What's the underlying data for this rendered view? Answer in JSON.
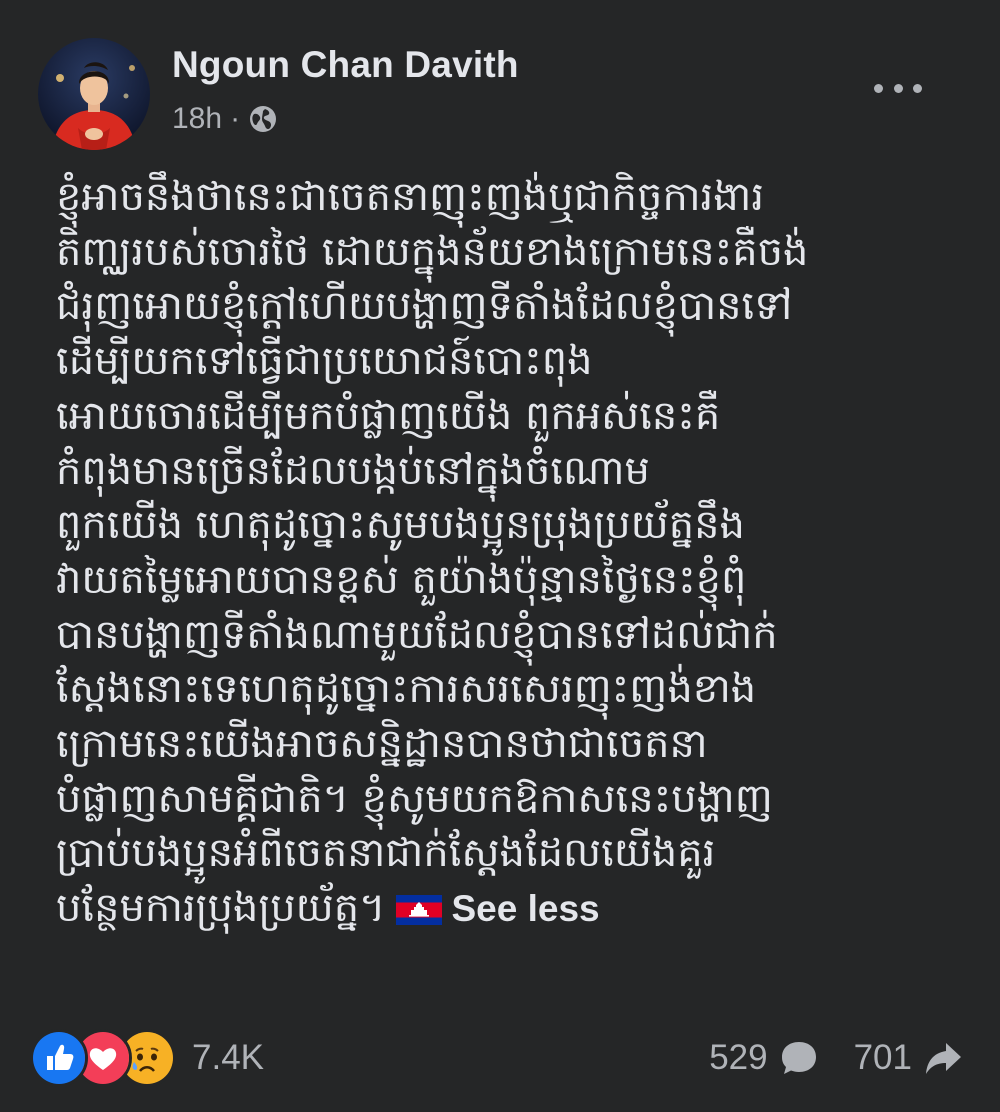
{
  "post": {
    "author": "Ngoun Chan Davith",
    "time": "18h",
    "separator": "·",
    "privacy_icon": "globe-icon",
    "more_icon": "ellipsis-icon",
    "lines": [
      "ខ្ញុំអាចនឹងថានេះជាចេតនាញុះញង់ឬជាកិច្ចការងារ",
      "តិញ្ឈរបស់ចោរថៃ ដោយក្នុងន័យខាងក្រោមនេះគឺចង់",
      "ជំរុញអោយខ្ញុំក្តៅហើយបង្ហាញទីតាំងដែលខ្ញុំបានទៅ",
      "ដើម្បីយកទៅធ្វើជាប្រយោជន៍បោះពុង",
      "អោយចោរដើម្បីមកបំផ្លាញយើង ពួកអស់នេះគឺ",
      "កំពុងមានច្រើនដែលបង្កប់នៅក្នុងចំណោម",
      "ពួកយើង ហេតុដូច្នោះសូមបងប្អូនប្រុងប្រយ័ត្ននឹង",
      "វាយតម្លៃអោយបានខ្ពស់ តួយ៉ាងប៉ុន្មានថ្ងៃនេះខ្ញុំពុំ",
      "បានបង្ហាញទីតាំងណាមួយដែលខ្ញុំបានទៅដល់ជាក់",
      "ស្តែងនោះទេហេតុដូច្នោះការសរសេរញុះញង់ខាង",
      "ក្រោមនេះយើងអាចសន្និដ្ឋានបានថាជាចេតនា",
      "បំផ្លាញសាមគ្គីជាតិ។ ខ្ញុំសូមយកឱកាសនេះបង្ហាញ",
      "ប្រាប់បងប្អូនអំពីចេតនាជាក់ស្តែងដែលយើងគួរ"
    ],
    "last_line": "បន្ថែមការប្រុងប្រយ័ត្ន។",
    "flag_icon": "cambodia-flag-icon",
    "see_less": "See less"
  },
  "footer": {
    "reactions": [
      "like-icon",
      "love-icon",
      "sad-icon"
    ],
    "reaction_count": "7.4K",
    "comment_count": "529",
    "comment_icon": "comment-icon",
    "share_count": "701",
    "share_icon": "share-icon"
  },
  "colors": {
    "background": "#252627",
    "text_primary": "#e4e6eb",
    "text_secondary": "#b0b3b8",
    "like_blue": "#1877f2",
    "love_red": "#f33e58",
    "sad_yellow": "#f7b125",
    "avatar_shirt": "#d82a20"
  }
}
